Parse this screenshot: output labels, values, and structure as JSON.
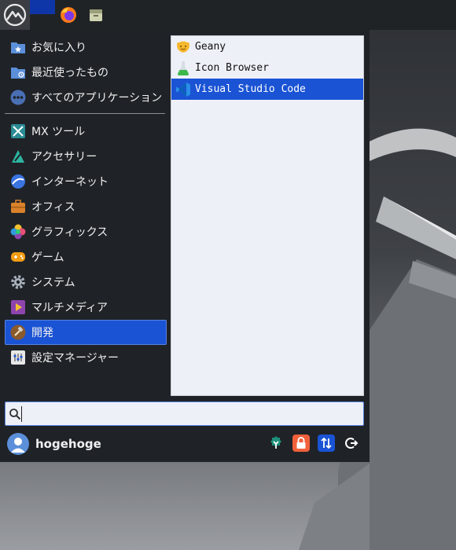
{
  "panel": {
    "menu_icon": "mx-logo-icon",
    "launchers": [
      {
        "name": "firefox-icon"
      },
      {
        "name": "file-manager-icon"
      }
    ]
  },
  "menu": {
    "categories": [
      {
        "label": "お気に入り",
        "icon": "favorites-folder-icon"
      },
      {
        "label": "最近使ったもの",
        "icon": "recent-folder-icon"
      },
      {
        "label": "すべてのアプリケーション",
        "icon": "all-apps-icon"
      },
      {
        "label": "MX ツール",
        "icon": "mx-tools-icon"
      },
      {
        "label": "アクセサリー",
        "icon": "accessories-icon"
      },
      {
        "label": "インターネット",
        "icon": "internet-icon"
      },
      {
        "label": "オフィス",
        "icon": "office-icon"
      },
      {
        "label": "グラフィックス",
        "icon": "graphics-icon"
      },
      {
        "label": "ゲーム",
        "icon": "games-icon"
      },
      {
        "label": "システム",
        "icon": "system-icon"
      },
      {
        "label": "マルチメディア",
        "icon": "multimedia-icon"
      },
      {
        "label": "開発",
        "icon": "development-icon",
        "active": true
      },
      {
        "label": "設定マネージャー",
        "icon": "settings-manager-icon"
      }
    ],
    "apps": [
      {
        "label": "Geany",
        "icon": "geany-icon"
      },
      {
        "label": "Icon Browser",
        "icon": "icon-browser-icon"
      },
      {
        "label": "Visual Studio Code",
        "icon": "vscode-icon",
        "selected": true
      }
    ],
    "search": {
      "value": "",
      "placeholder": ""
    },
    "user": {
      "name": "hogehoge"
    },
    "actions": [
      {
        "name": "settings-action-icon",
        "color": "#1e8f7a"
      },
      {
        "name": "lock-screen-icon",
        "color": "#f0603a"
      },
      {
        "name": "switch-user-icon",
        "color": "#1a53d4"
      },
      {
        "name": "logout-icon",
        "color": "#2a2e33"
      }
    ]
  },
  "colors": {
    "accent": "#1a53d4",
    "menu_bg": "#1f2327",
    "panel_bg": "#202326"
  }
}
